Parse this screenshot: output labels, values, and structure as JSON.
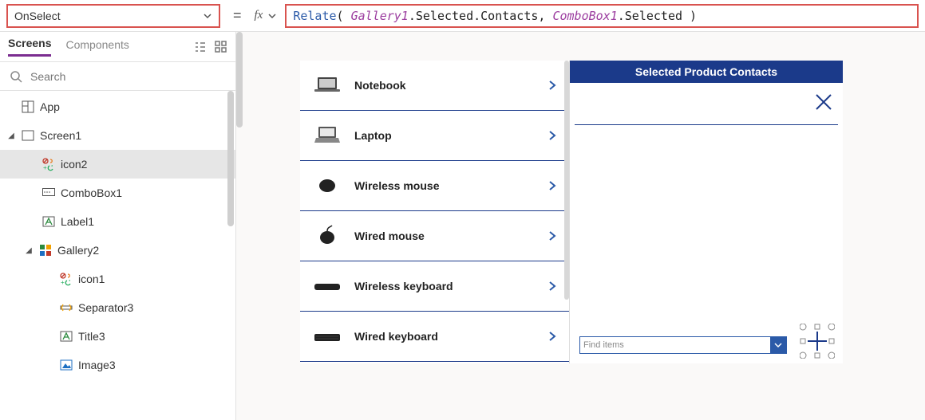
{
  "formula_bar": {
    "property": "OnSelect",
    "equals": "=",
    "fx_label": "fx",
    "tokens": {
      "func": "Relate",
      "open": "( ",
      "ref1": "Gallery1",
      "mid1": ".Selected.Contacts, ",
      "ref2": "ComboBox1",
      "mid2": ".Selected )"
    }
  },
  "left_panel": {
    "tab_screens": "Screens",
    "tab_components": "Components",
    "search_placeholder": "Search",
    "tree": {
      "app": "App",
      "screen1": "Screen1",
      "icon2": "icon2",
      "combobox1": "ComboBox1",
      "label1": "Label1",
      "gallery2": "Gallery2",
      "icon1": "icon1",
      "separator3": "Separator3",
      "title3": "Title3",
      "image3": "Image3"
    }
  },
  "canvas": {
    "header": "Selected Product Contacts",
    "combo_placeholder": "Find items",
    "products": [
      {
        "name": "Notebook"
      },
      {
        "name": "Laptop"
      },
      {
        "name": "Wireless mouse"
      },
      {
        "name": "Wired mouse"
      },
      {
        "name": "Wireless keyboard"
      },
      {
        "name": "Wired keyboard"
      }
    ]
  }
}
